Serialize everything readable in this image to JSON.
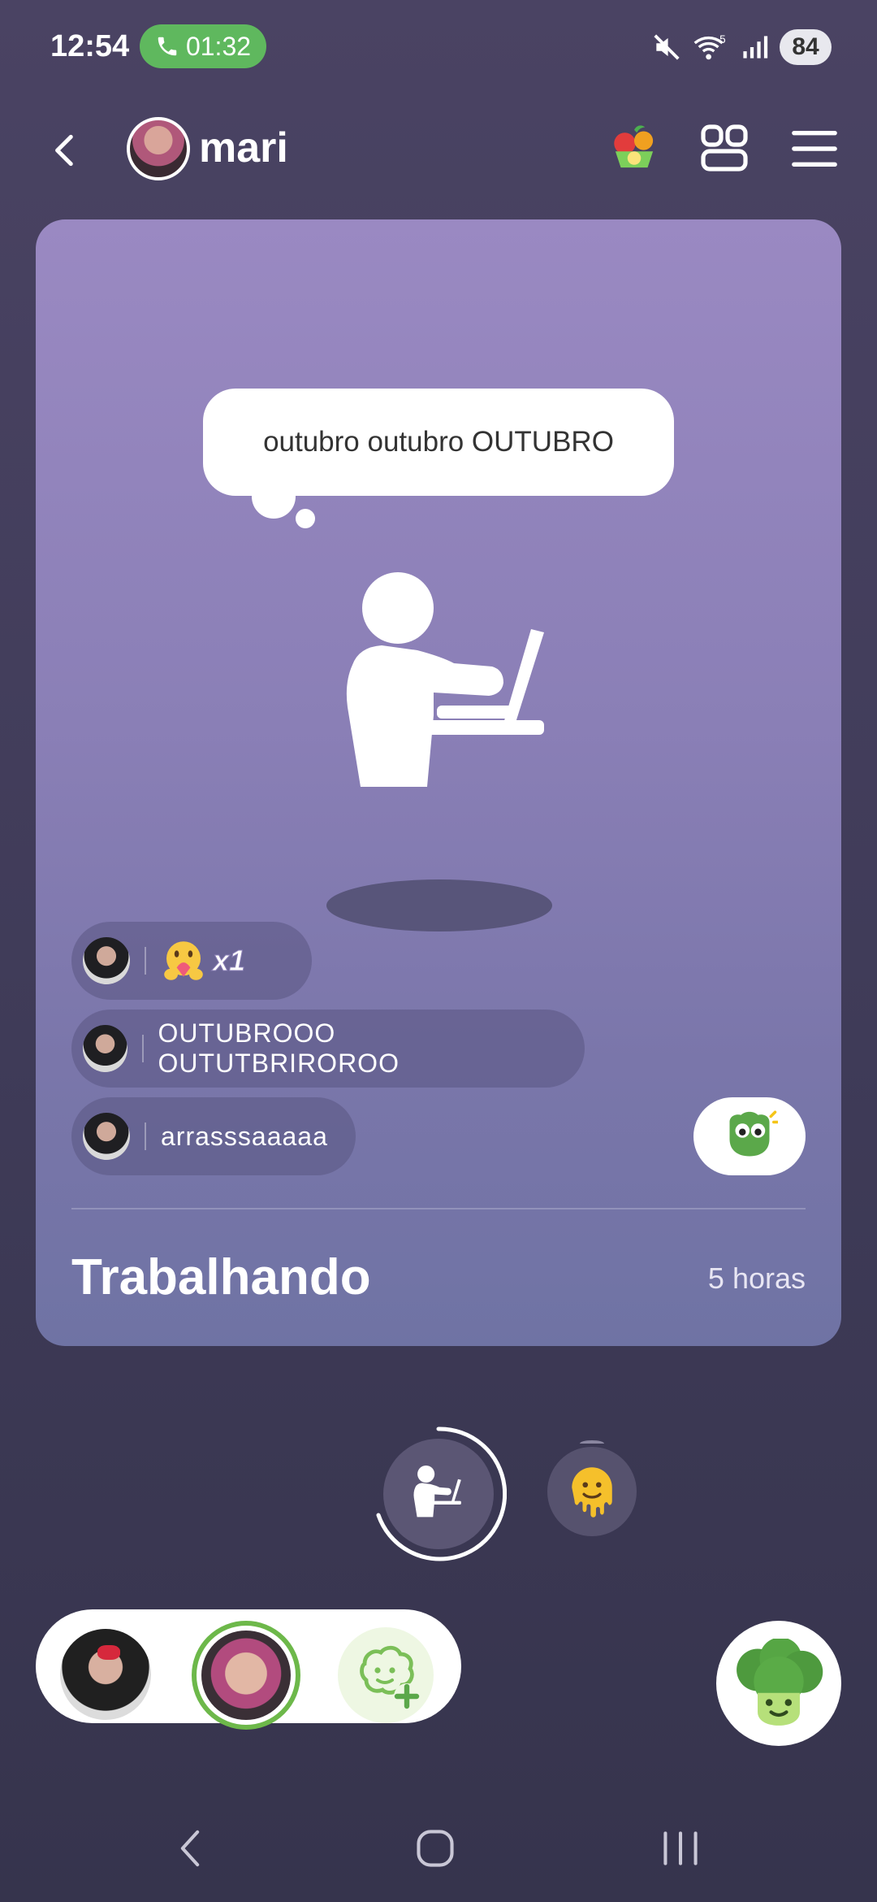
{
  "status_bar": {
    "time": "12:54",
    "call_timer": "01:32",
    "battery": "84",
    "call_color": "#5fb85e",
    "icons": [
      "mute-icon",
      "wifi-icon",
      "signal-icon"
    ]
  },
  "header": {
    "contact_name": "mari",
    "icons": [
      "back-arrow-icon",
      "fruit-basket-icon",
      "widget-grid-icon",
      "hamburger-menu-icon"
    ]
  },
  "card": {
    "thought_bubble": "outubro outubro OUTUBRO",
    "messages": [
      {
        "type": "reaction",
        "count_label": "x1",
        "icon": "hug-heart-emoji-icon"
      },
      {
        "type": "text",
        "text": "OUTUBROOO OUTUTBRIROROO"
      },
      {
        "type": "text",
        "text": "arrasssaaaaa"
      }
    ],
    "status_title": "Trabalhando",
    "status_duration": "5 horas",
    "react_button_icon": "green-mascot-icon"
  },
  "controls": {
    "active_status_icon": "working-at-laptop-icon",
    "emoji_status_icon": "melting-face-emoji-icon"
  },
  "friends": {
    "add_friend_icon": "add-friend-icon",
    "mascot_icon": "broccoli-mascot-icon",
    "accent": "#6db84a"
  },
  "system_nav": [
    "back-nav-icon",
    "home-nav-icon",
    "recents-nav-icon"
  ]
}
